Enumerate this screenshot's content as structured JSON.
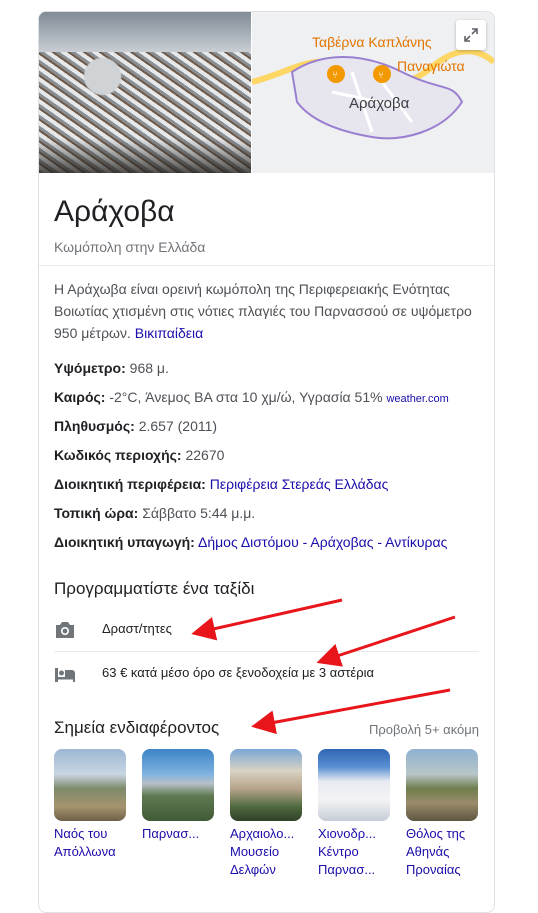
{
  "map": {
    "label_tavern": "Ταβέρνα Καπλάνης",
    "label_panagiota": "Παναγιώτα",
    "label_town": "Αράχοβα"
  },
  "header": {
    "title": "Αράχοβα",
    "subtitle": "Κωμόπολη στην Ελλάδα"
  },
  "description": {
    "text": "Η Αράχωβα είναι ορεινή κωμόπολη της Περιφερειακής Ενότητας Βοιωτίας χτισμένη στις νότιες πλαγιές του Παρνασσού σε υψόμετρο 950 μέτρων.",
    "source_link": "Βικιπαίδεια"
  },
  "facts": [
    {
      "label": "Υψόμετρο:",
      "value": "968 μ."
    },
    {
      "label": "Καιρός:",
      "value": "-2°C, Άνεμος ΒΑ στα 10 χμ/ώ, Υγρασία 51%",
      "link": "weather.com"
    },
    {
      "label": "Πληθυσμός:",
      "value": "2.657 (2011)"
    },
    {
      "label": "Κωδικός περιοχής:",
      "value": "22670"
    },
    {
      "label": "Διοικητική περιφέρεια:",
      "link": "Περιφέρεια Στερεάς Ελλάδας"
    },
    {
      "label": "Τοπική ώρα:",
      "value": "Σάββατο 5:44 μ.μ."
    },
    {
      "label": "Διοικητική υπαγωγή:",
      "link": "Δήμος Διστόμου - Αράχοβας - Αντίκυρας"
    }
  ],
  "trip": {
    "title": "Προγραμματίστε ένα ταξίδι",
    "activities": "Δραστ/τητες",
    "hotels": "63 € κατά μέσο όρο σε ξενοδοχεία με 3 αστέρια"
  },
  "poi": {
    "title": "Σημεία ενδιαφέροντος",
    "more": "Προβολή 5+ ακόμη",
    "items": [
      {
        "label": "Ναός του Απόλλωνα"
      },
      {
        "label": "Παρνασ..."
      },
      {
        "label": "Αρχαιολο... Μουσείο Δελφών"
      },
      {
        "label": "Χιονοδρ... Κέντρο Παρνασ..."
      },
      {
        "label": "Θόλος της Αθηνάς Προναίας"
      }
    ]
  },
  "colors": {
    "link": "#1a0dab",
    "annotation_arrow": "#e8151b",
    "map_marker": "#f29900"
  }
}
